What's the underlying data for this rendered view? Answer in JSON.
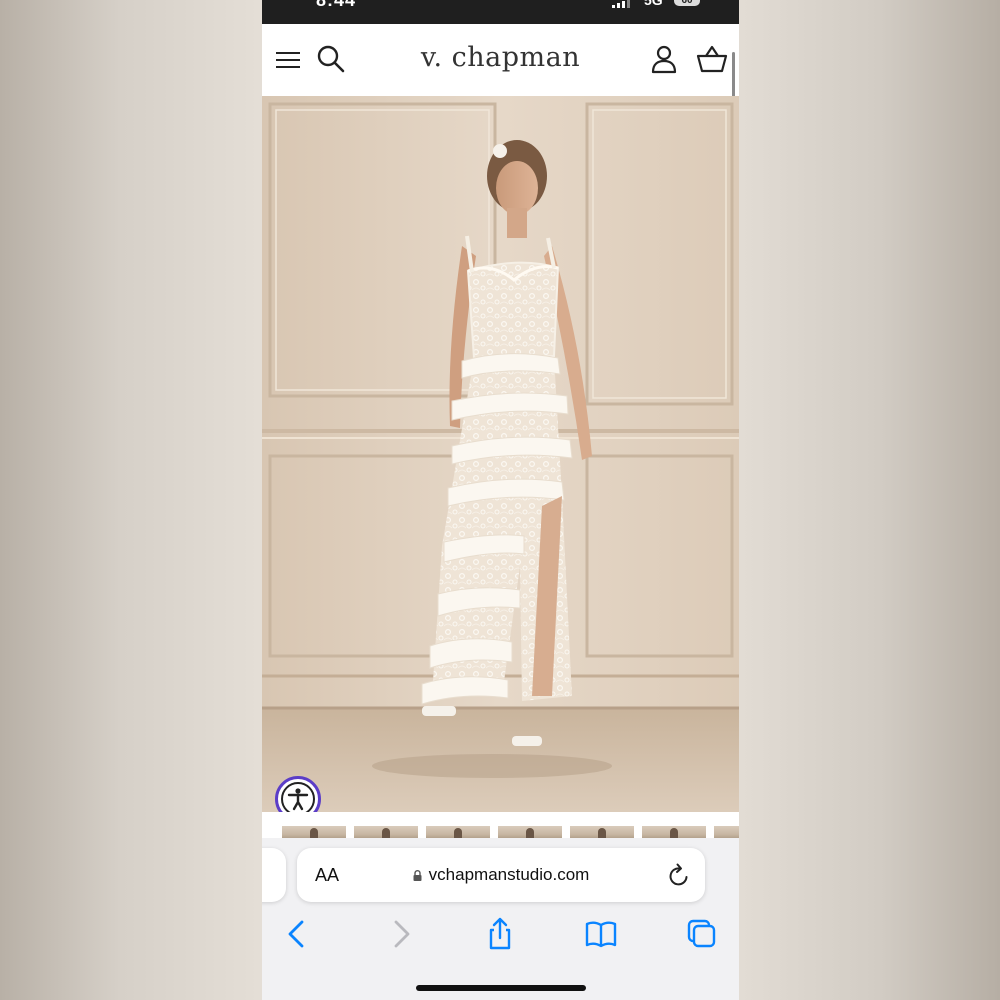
{
  "status_bar": {
    "time": "8:44",
    "network": "5G",
    "battery": "60"
  },
  "site": {
    "brand": "v. chapman",
    "icons": {
      "menu": "hamburger-menu-icon",
      "search": "search-icon",
      "account": "user-icon",
      "cart": "basket-icon"
    }
  },
  "product": {
    "thumbnail_count": 7
  },
  "browser": {
    "text_size_label": "AA",
    "url": "vchapmanstudio.com",
    "toolbar": [
      "back-icon",
      "forward-icon",
      "share-icon",
      "bookmarks-icon",
      "tabs-icon"
    ]
  },
  "colors": {
    "accessibility_accent": "#5b3dc7",
    "safari_blue": "#0a84ff",
    "disabled_gray": "#b9b9be"
  }
}
